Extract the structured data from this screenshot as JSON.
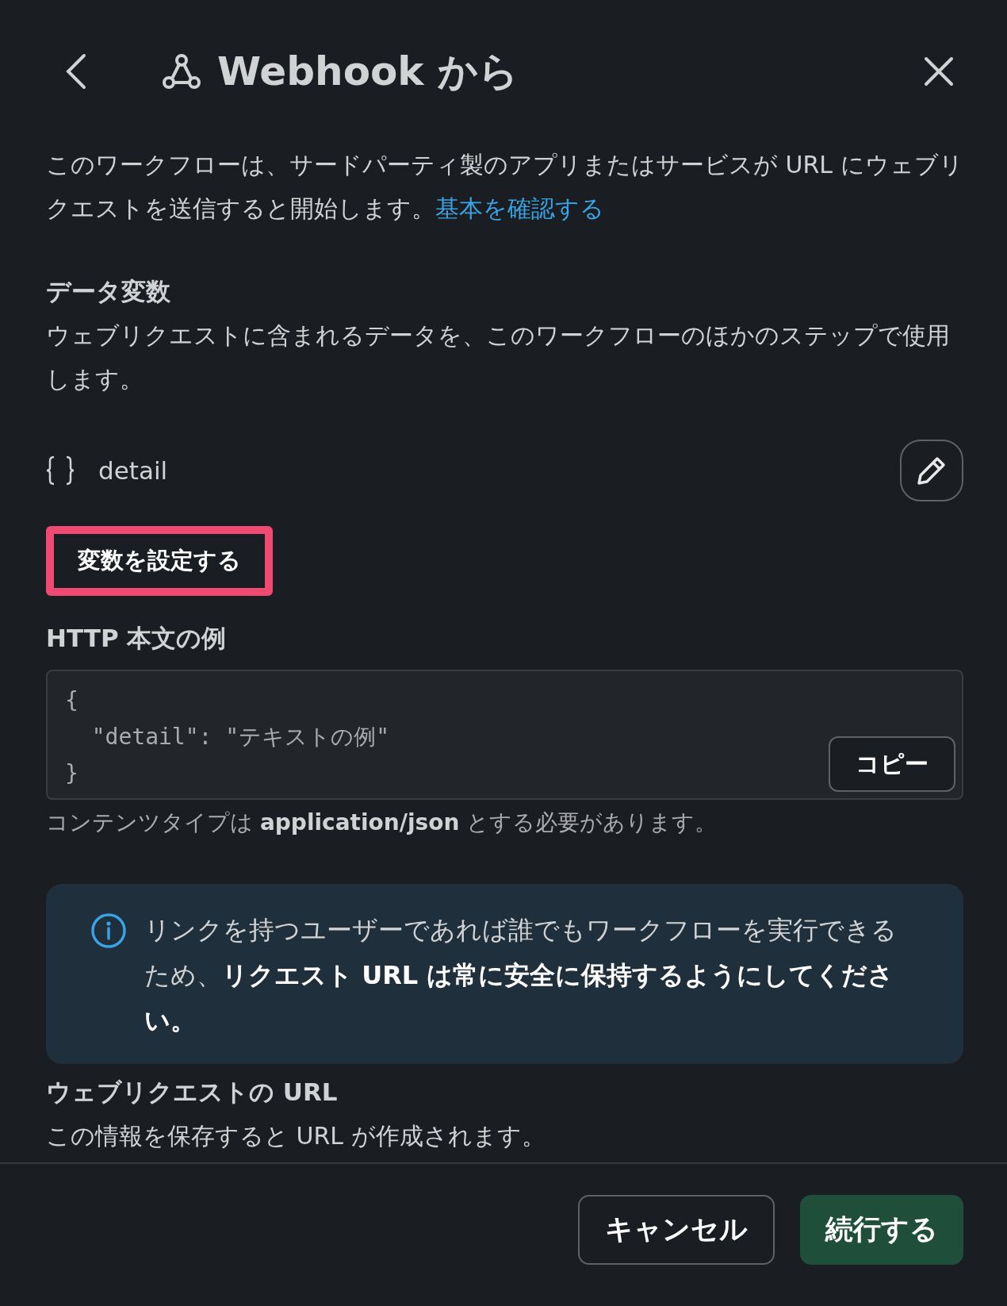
{
  "header": {
    "title": "Webhook から"
  },
  "intro": {
    "text": "このワークフローは、サードパーティ製のアプリまたはサービスが URL にウェブリクエストを送信すると開始します。",
    "link": "基本を確認する"
  },
  "data_variables": {
    "title": "データ変数",
    "description": "ウェブリクエストに含まれるデータを、このワークフローのほかのステップで使用します。",
    "variables": [
      {
        "name": "detail"
      }
    ],
    "set_button": {
      "label": "変数を設定する",
      "highlighted": true
    }
  },
  "http_example": {
    "title": "HTTP 本文の例",
    "code_lines": [
      "{",
      "  \"detail\": \"テキストの例\"",
      "}"
    ],
    "copy_label": "コピー",
    "note": "コンテンツタイプは **application/json** とする必要があります。"
  },
  "info": {
    "text": "リンクを持つユーザーであれば誰でもワークフローを実行できるため、**リクエスト URL は常に安全に保持するようにしてください。**"
  },
  "request_url": {
    "title": "ウェブリクエストの URL",
    "description": "この情報を保存すると URL が作成されます。"
  },
  "footer": {
    "buttons": [
      {
        "label": "キャンセル",
        "kind": "secondary"
      },
      {
        "label": "続行する",
        "kind": "primary"
      }
    ]
  }
}
